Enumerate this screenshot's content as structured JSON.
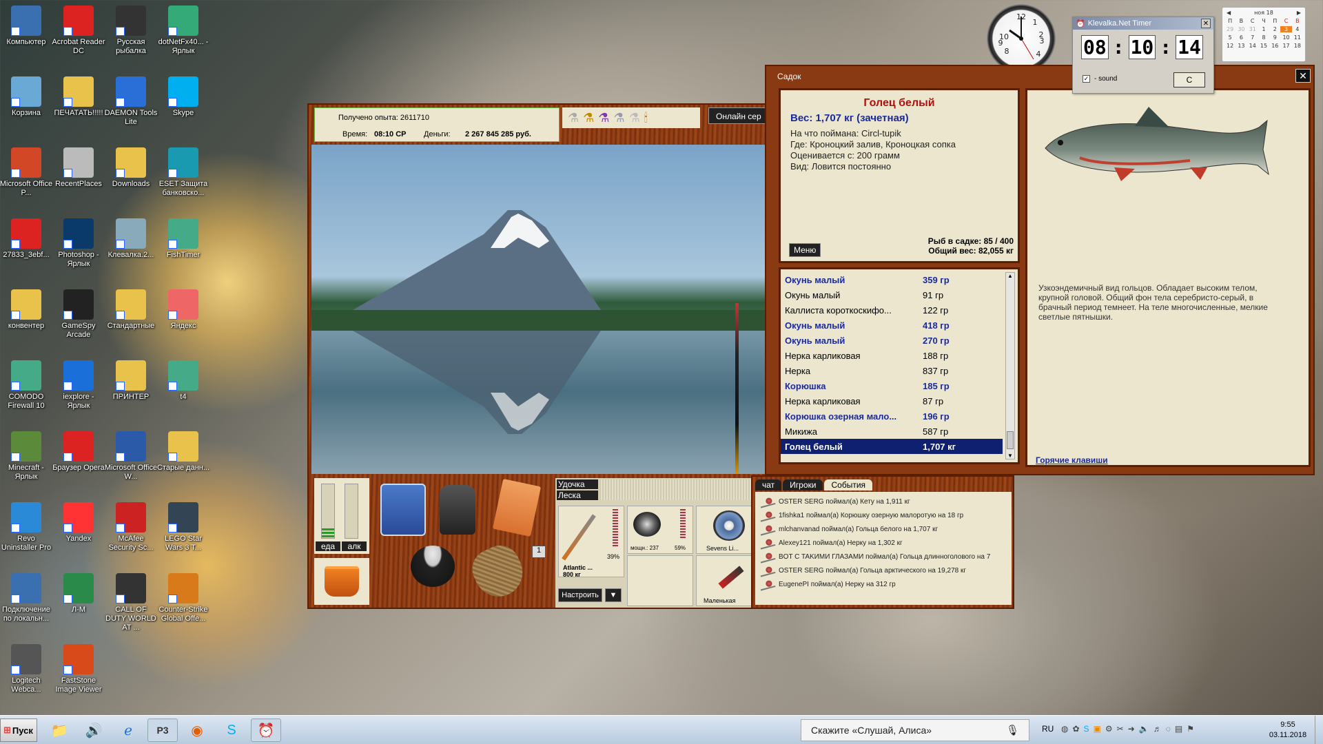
{
  "desktop_icons": [
    {
      "label": "Компьютер",
      "color": "#3a6fb0"
    },
    {
      "label": "Acrobat Reader DC",
      "color": "#d22"
    },
    {
      "label": "Русская рыбалка",
      "color": "#333"
    },
    {
      "label": "dotNetFx40... - Ярлык",
      "color": "#3a7"
    },
    {
      "label": "Корзина",
      "color": "#6aa8d6"
    },
    {
      "label": "ПЕЧАТАТЬ!!!!!",
      "color": "#e8c24a"
    },
    {
      "label": "DAEMON Tools Lite",
      "color": "#2a6fd8"
    },
    {
      "label": "Skype",
      "color": "#00aff0"
    },
    {
      "label": "Microsoft Office P...",
      "color": "#d24726"
    },
    {
      "label": "RecentPlaces",
      "color": "#bbb"
    },
    {
      "label": "Downloads",
      "color": "#e8c24a"
    },
    {
      "label": "ESET Защита банковско...",
      "color": "#1a9ab0"
    },
    {
      "label": "27833_3ebf...",
      "color": "#d22"
    },
    {
      "label": "Photoshop - Ярлык",
      "color": "#0a3a6a"
    },
    {
      "label": "Клевалка.2...",
      "color": "#8ab"
    },
    {
      "label": "FishTimer",
      "color": "#4a8"
    },
    {
      "label": "конвентер",
      "color": "#e8c24a"
    },
    {
      "label": "GameSpy Arcade",
      "color": "#222"
    },
    {
      "label": "Стандартные",
      "color": "#e8c24a"
    },
    {
      "label": "Яндекс",
      "color": "#e66"
    },
    {
      "label": "COMODO Firewall 10",
      "color": "#4a8"
    },
    {
      "label": "iexplore - Ярлык",
      "color": "#1a6fd8"
    },
    {
      "label": "ПРИНТЕР",
      "color": "#e8c24a"
    },
    {
      "label": "t4",
      "color": "#4a8"
    },
    {
      "label": "Minecraft - Ярлык",
      "color": "#5a8a3a"
    },
    {
      "label": "Браузер Opera",
      "color": "#d22"
    },
    {
      "label": "Microsoft Office W...",
      "color": "#2a5aa8"
    },
    {
      "label": "Старые данн...",
      "color": "#e8c24a"
    },
    {
      "label": "Revo Uninstaller Pro",
      "color": "#2a8ad8"
    },
    {
      "label": "Yandex",
      "color": "#f33"
    },
    {
      "label": "McAfee Security Sc...",
      "color": "#c22"
    },
    {
      "label": "LEGO Star Wars 3 T...",
      "color": "#345"
    },
    {
      "label": "Подключение по локальн...",
      "color": "#3a6fb0"
    },
    {
      "label": "Л-М",
      "color": "#2a8a4a"
    },
    {
      "label": "CALL OF DUTY WORLD AT ...",
      "color": "#333"
    },
    {
      "label": "Counter-Strike Global Offe...",
      "color": "#d87a1a"
    },
    {
      "label": "Logitech Webca...",
      "color": "#555"
    },
    {
      "label": "FastStone Image Viewer",
      "color": "#d84a1a"
    }
  ],
  "game": {
    "experience_label": "Получено опыта: 2611710",
    "time_label": "Время:",
    "time_value": "08:10 СР",
    "money_label": "Деньги:",
    "money_value": "2 267 845 285 руб.",
    "online_label": "Онлайн сер",
    "food_label": "еда",
    "alc_label": "алк",
    "rod_label": "Удочка",
    "line_label": "Леска",
    "rod_name": "Atlantic ...",
    "rod_weight": "800 кг",
    "rod_percent": "39%",
    "reel_power": "мощн.: 237",
    "reel_percent": "59%",
    "line_name": "Sevens Li...",
    "lure_name": "Маленькая",
    "setup_button": "Настроить",
    "bag_count": "1",
    "chat_tabs": [
      "чат",
      "Игроки",
      "События"
    ],
    "events": [
      "OSTER SERG поймал(а) Кету на 1,911 кг",
      "1fishka1 поймал(а) Корюшку озерную малоротую на 18 гр",
      "mlchanvanad поймал(а) Гольца белого на 1,707 кг",
      "Alexey121 поймал(а) Нерку на 1,302 кг",
      "BOT C TAKИMИ ГЛАЗАМИ поймал(а) Гольца длинноголового на 7",
      "OSTER SERG поймал(а) Гольца арктического на 19,278 кг",
      "EugenePI поймал(а) Нерку на 312 гр"
    ]
  },
  "sadok": {
    "title": "Садок",
    "fish_name": "Голец белый",
    "fish_weight": "Вес: 1,707 кг (зачетная)",
    "caught_on": "На что поймана: Circl-tupik",
    "where": "Где: Кроноцкий залив, Кроноцкая сопка",
    "valued_from": "Оценивается с: 200 грамм",
    "kind": "Вид: Ловится постоянно",
    "menu_button": "Меню",
    "fish_count": "Рыб в садке: 85 / 400",
    "total_weight": "Общий вес: 82,055 кг",
    "fish_list": [
      {
        "name": "Окунь малый",
        "weight": "359 гр",
        "bold": true
      },
      {
        "name": "Окунь малый",
        "weight": "91 гр",
        "bold": false
      },
      {
        "name": "Каллиста короткоскифо...",
        "weight": "122 гр",
        "bold": false
      },
      {
        "name": "Окунь малый",
        "weight": "418 гр",
        "bold": true
      },
      {
        "name": "Окунь малый",
        "weight": "270 гр",
        "bold": true
      },
      {
        "name": "Нерка карликовая",
        "weight": "188 гр",
        "bold": false
      },
      {
        "name": "Нерка",
        "weight": "837 гр",
        "bold": false
      },
      {
        "name": "Корюшка",
        "weight": "185 гр",
        "bold": true
      },
      {
        "name": "Нерка карликовая",
        "weight": "87 гр",
        "bold": false
      },
      {
        "name": "Корюшка озерная мало...",
        "weight": "196 гр",
        "bold": true
      },
      {
        "name": "Микижа",
        "weight": "587 гр",
        "bold": false
      },
      {
        "name": "Голец белый",
        "weight": "1,707 кг",
        "bold": true
      }
    ],
    "description": "Узкоэндемичный вид гольцов. Обладает высоким телом, крупной головой. Общий фон тела серебристо-серый, в брачный период темнеет. На теле многочисленные, мелкие светлые пятнышки.",
    "hotkeys_link": "Горячие клавиши"
  },
  "timer": {
    "title": "Klevalka.Net Timer",
    "hh": "08",
    "mm": "10",
    "ss": "14",
    "sound_label": "- sound",
    "c_button": "C"
  },
  "calendar": {
    "month": "ноя 18",
    "weekdays": [
      "П",
      "В",
      "С",
      "Ч",
      "П",
      "С",
      "В"
    ],
    "rows": [
      [
        "29",
        "30",
        "31",
        "1",
        "2",
        "3",
        "4"
      ],
      [
        "5",
        "6",
        "7",
        "8",
        "9",
        "10",
        "11"
      ],
      [
        "12",
        "13",
        "14",
        "15",
        "16",
        "17",
        "18"
      ]
    ],
    "today": "3"
  },
  "taskbar": {
    "start_label": "Пуск",
    "search_text": "Скажите «Слушай, Алиса»",
    "lang": "RU",
    "clock_time": "9:55",
    "clock_date": "03.11.2018"
  }
}
